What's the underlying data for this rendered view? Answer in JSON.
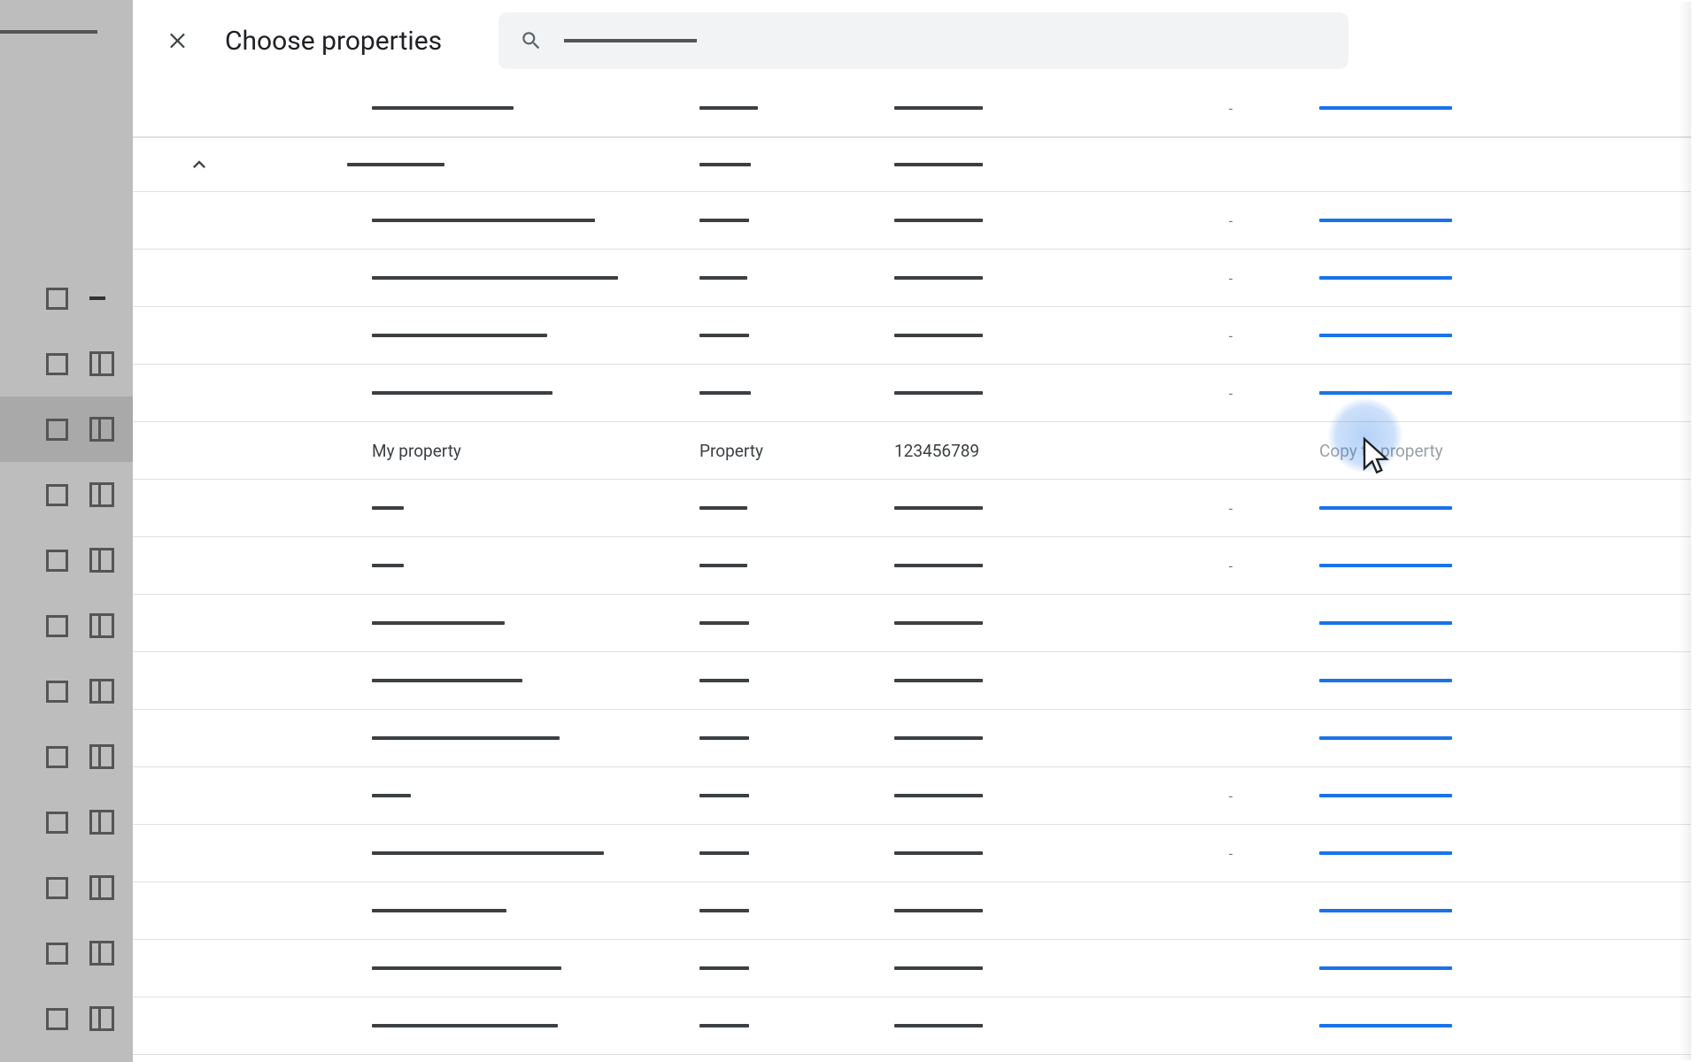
{
  "header": {
    "title": "Choose properties",
    "search_placeholder": "Search"
  },
  "colors": {
    "link": "#1a73e8",
    "text": "#3c4043",
    "disabled": "#9aa0a6"
  },
  "background_sidebar": {
    "rows_with_icon": 10,
    "first_row_has_dash_only": true,
    "highlighted_row_index": 2
  },
  "group": {
    "expanded": true
  },
  "visible_text_row": {
    "name": "My property",
    "type": "Property",
    "id": "123456789",
    "action": "Copy to property"
  },
  "status_placeholder": "-",
  "rows": [
    {
      "kind": "item",
      "name_w": 160,
      "type_w": 66,
      "id_w": 100,
      "status": "-",
      "action_w": 150
    },
    {
      "kind": "group",
      "name_w": 110,
      "type_w": 58,
      "id_w": 100
    },
    {
      "kind": "item",
      "name_w": 252,
      "type_w": 56,
      "id_w": 100,
      "status": "-",
      "action_w": 150
    },
    {
      "kind": "item",
      "name_w": 278,
      "type_w": 54,
      "id_w": 100,
      "status": "-",
      "action_w": 150
    },
    {
      "kind": "item",
      "name_w": 198,
      "type_w": 56,
      "id_w": 100,
      "status": "-",
      "action_w": 150
    },
    {
      "kind": "item",
      "name_w": 204,
      "type_w": 58,
      "id_w": 100,
      "status": "-",
      "action_w": 150
    },
    {
      "kind": "text",
      "name": "My property",
      "type": "Property",
      "id": "123456789",
      "action": "Copy to property",
      "highlight": true
    },
    {
      "kind": "item",
      "name_w": 36,
      "type_w": 54,
      "id_w": 100,
      "status": "-",
      "action_w": 150
    },
    {
      "kind": "item",
      "name_w": 36,
      "type_w": 54,
      "id_w": 100,
      "status": "-",
      "action_w": 150
    },
    {
      "kind": "item",
      "name_w": 150,
      "type_w": 56,
      "id_w": 100,
      "status": "",
      "action_w": 150
    },
    {
      "kind": "item",
      "name_w": 170,
      "type_w": 56,
      "id_w": 100,
      "status": "",
      "action_w": 150
    },
    {
      "kind": "item",
      "name_w": 212,
      "type_w": 56,
      "id_w": 100,
      "status": "",
      "action_w": 150
    },
    {
      "kind": "item",
      "name_w": 44,
      "type_w": 56,
      "id_w": 100,
      "status": "-",
      "action_w": 150
    },
    {
      "kind": "item",
      "name_w": 262,
      "type_w": 56,
      "id_w": 100,
      "status": "-",
      "action_w": 150
    },
    {
      "kind": "item",
      "name_w": 152,
      "type_w": 56,
      "id_w": 100,
      "status": "",
      "action_w": 150
    },
    {
      "kind": "item",
      "name_w": 214,
      "type_w": 56,
      "id_w": 100,
      "status": "",
      "action_w": 150
    },
    {
      "kind": "item",
      "name_w": 210,
      "type_w": 56,
      "id_w": 100,
      "status": "",
      "action_w": 150
    }
  ]
}
